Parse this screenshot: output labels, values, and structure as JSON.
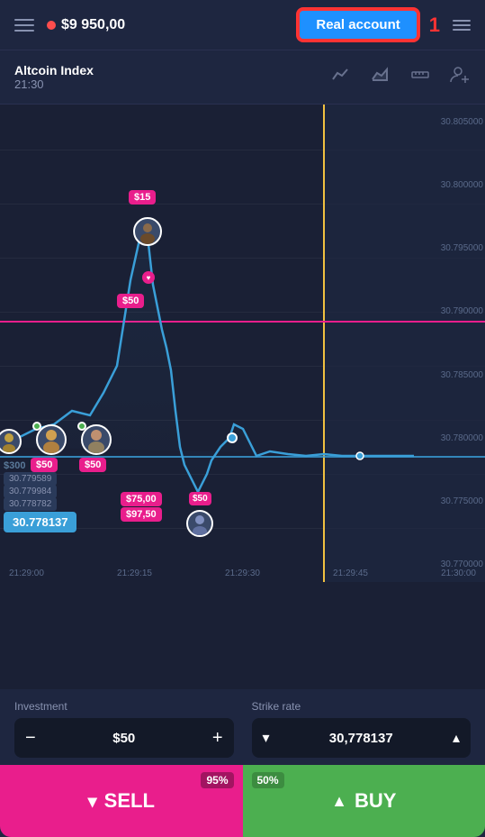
{
  "header": {
    "menu_label": "menu",
    "balance": "$9 950,00",
    "real_account_label": "Real account",
    "number_badge": "1",
    "layers_label": "layers"
  },
  "instrument": {
    "name": "Altcoin Index",
    "time": "21:30",
    "toolbar": {
      "line_icon": "line-chart-icon",
      "area_icon": "area-chart-icon",
      "ruler_icon": "ruler-icon",
      "person_icon": "add-person-icon"
    }
  },
  "chart": {
    "y_labels": [
      "30.805000",
      "30.800000",
      "30.795000",
      "30.790000",
      "30.785000",
      "30.780000",
      "30.775000",
      "30.770000"
    ],
    "x_labels": [
      "21:29:00",
      "21:29:15",
      "21:29:30",
      "21:29:45",
      "21:30:00"
    ],
    "current_price": "30.778137",
    "trade_badges": [
      {
        "label": "$15",
        "type": "pink"
      },
      {
        "label": "$50",
        "type": "pink"
      },
      {
        "label": "$50",
        "type": "pink"
      },
      {
        "label": "$50",
        "type": "pink"
      },
      {
        "label": "$75,00",
        "type": "pink"
      },
      {
        "label": "$50",
        "type": "pink"
      },
      {
        "label": "$97,50",
        "type": "pink"
      }
    ],
    "price_stacked": [
      "30.779589",
      "30.779984",
      "30.778782"
    ],
    "price_current_box": "30.778137",
    "dollar_300": "$300"
  },
  "controls": {
    "investment_label": "Investment",
    "investment_value": "$50",
    "minus_label": "−",
    "plus_label": "+",
    "strike_rate_label": "Strike rate",
    "strike_rate_value": "30,778137",
    "chevron_down": "▾",
    "chevron_up": "▴"
  },
  "actions": {
    "sell_label": "SELL",
    "sell_pct": "95%",
    "sell_arrow": "▾",
    "buy_label": "BUY",
    "buy_pct": "50%",
    "buy_arrow": "▲"
  }
}
